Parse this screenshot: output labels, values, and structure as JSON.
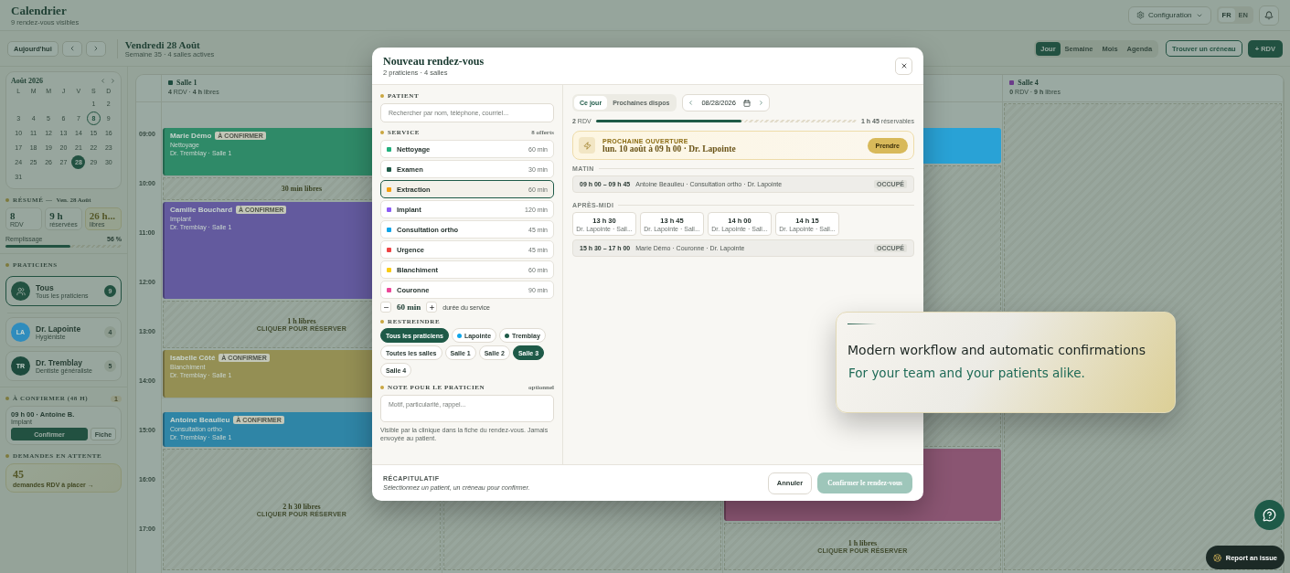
{
  "header": {
    "title": "Calendrier",
    "subtitle": "9 rendez-vous visibles",
    "config_label": "Configuration",
    "languages": [
      {
        "label": "FR",
        "selected": true
      },
      {
        "label": "EN",
        "selected": false
      }
    ]
  },
  "toolbar": {
    "today_label": "Aujourd'hui",
    "date_title": "Vendredi 28 Août",
    "date_subtitle": "Semaine 35 · 4 salles actives",
    "views": [
      {
        "label": "Jour",
        "selected": true
      },
      {
        "label": "Semaine",
        "selected": false
      },
      {
        "label": "Mois",
        "selected": false
      },
      {
        "label": "Agenda",
        "selected": false
      }
    ],
    "find_slot_label": "Trouver un créneau",
    "new_label": "+ RDV"
  },
  "sidebar": {
    "mini_calendar": {
      "title": "Août 2026",
      "weekdays": [
        "L",
        "M",
        "M",
        "J",
        "V",
        "S",
        "D"
      ],
      "weeks": [
        [
          {
            "day": "1",
            "today": false,
            "selected": false
          },
          {
            "day": "2",
            "today": false,
            "selected": false
          }
        ],
        [
          {
            "day": "3",
            "today": false,
            "selected": false
          },
          {
            "day": "4",
            "today": false,
            "selected": false
          },
          {
            "day": "5",
            "today": false,
            "selected": false
          },
          {
            "day": "6",
            "today": false,
            "selected": false
          },
          {
            "day": "7",
            "today": false,
            "selected": false
          },
          {
            "day": "8",
            "today": true,
            "selected": false
          },
          {
            "day": "9",
            "today": false,
            "selected": false
          }
        ],
        [
          {
            "day": "10",
            "today": false,
            "selected": false
          },
          {
            "day": "11",
            "today": false,
            "selected": false
          },
          {
            "day": "12",
            "today": false,
            "selected": false
          },
          {
            "day": "13",
            "today": false,
            "selected": false
          },
          {
            "day": "14",
            "today": false,
            "selected": false
          },
          {
            "day": "15",
            "today": false,
            "selected": false
          },
          {
            "day": "16",
            "today": false,
            "selected": false
          }
        ],
        [
          {
            "day": "17",
            "today": false,
            "selected": false
          },
          {
            "day": "18",
            "today": false,
            "selected": false
          },
          {
            "day": "19",
            "today": false,
            "selected": false
          },
          {
            "day": "20",
            "today": false,
            "selected": false
          },
          {
            "day": "21",
            "today": false,
            "selected": false
          },
          {
            "day": "22",
            "today": false,
            "selected": false
          },
          {
            "day": "23",
            "today": false,
            "selected": false
          }
        ],
        [
          {
            "day": "24",
            "today": false,
            "selected": false
          },
          {
            "day": "25",
            "today": false,
            "selected": false
          },
          {
            "day": "26",
            "today": false,
            "selected": false
          },
          {
            "day": "27",
            "today": false,
            "selected": false
          },
          {
            "day": "28",
            "today": false,
            "selected": true
          },
          {
            "day": "29",
            "today": false,
            "selected": false
          },
          {
            "day": "30",
            "today": false,
            "selected": false
          }
        ],
        [
          {
            "day": "31",
            "today": false,
            "selected": false
          }
        ]
      ]
    },
    "summary": {
      "heading": "RÉSUMÉ —",
      "date": "Ven. 28 Août",
      "stats": [
        {
          "kind": "plain",
          "value": "8",
          "label": "RDV"
        },
        {
          "kind": "plain",
          "value": "9 h",
          "label": "réservées"
        },
        {
          "kind": "highlight",
          "value": "26 h...",
          "label": "libres"
        }
      ],
      "fill_label": "Remplissage",
      "fill_reading": "56 %",
      "level": 0.56
    },
    "practitioners_heading": "PRATICIENS",
    "practitioners": [
      {
        "kind": "all",
        "name": "Tous",
        "role": "Tous les praticiens",
        "count": "9",
        "selected": true
      },
      {
        "kind": "person",
        "initials": "LA",
        "color": "#2f8cbd",
        "name": "Dr. Lapointe",
        "role": "Hygiéniste",
        "count": "4",
        "selected": false
      },
      {
        "kind": "person",
        "initials": "TR",
        "color": "#1d4a3d",
        "name": "Dr. Tremblay",
        "role": "Dentiste généraliste",
        "count": "5",
        "selected": false
      }
    ],
    "to_confirm": {
      "heading": "À CONFIRMER (48 H)",
      "count": "1",
      "items": [
        {
          "title": "09 h 00 · Antoine B.",
          "service": "Implant",
          "confirm_label": "Confirmer",
          "file_label": "Fiche"
        }
      ]
    },
    "pending": {
      "heading": "DEMANDES EN ATTENTE",
      "count": "45",
      "label": "demandes RDV à placer →"
    }
  },
  "calendar": {
    "hours": [
      "09:00",
      "10:00",
      "11:00",
      "12:00",
      "13:00",
      "14:00",
      "15:00",
      "16:00",
      "17:00"
    ],
    "rooms": [
      {
        "name": "Salle 1",
        "color": "#1d4a3d",
        "stats": "**4** RDV · **4 h** libres",
        "blocks": [
          {
            "kind": "event",
            "color": "#2f8a68",
            "patient": "Marie Démo",
            "badge": "À CONFIRMER",
            "service": "Nettoyage",
            "detail": "Dr. Tremblay · Salle 1"
          },
          {
            "kind": "free",
            "label": "30 min libres"
          },
          {
            "kind": "event",
            "color": "#635a9e",
            "patient": "Camille Bouchard",
            "badge": "À CONFIRMER",
            "service": "Implant",
            "detail": "Dr. Tremblay · Salle 1"
          },
          {
            "kind": "free",
            "label": "1 h libres",
            "action": "CLIQUER POUR RÉSERVER"
          },
          {
            "kind": "event",
            "color": "#948f54",
            "patient": "Isabelle Côté",
            "badge": "À CONFIRMER",
            "service": "Blanchiment",
            "detail": "Dr. Tremblay · Salle 1"
          },
          {
            "kind": "event",
            "color": "#2f85a6",
            "patient": "Antoine Beaulieu",
            "badge": "À CONFIRMER",
            "service": "Consultation ortho",
            "detail": "Dr. Tremblay · Salle 1"
          },
          {
            "kind": "free",
            "label": "2 h 30 libres",
            "action": "CLIQUER POUR RÉSERVER"
          }
        ]
      },
      {
        "blocks": [
          {
            "kind": "free"
          }
        ]
      },
      {
        "blocks": [
          {
            "kind": "event",
            "color": "#29a2d6"
          },
          {
            "kind": "free"
          },
          {
            "kind": "event",
            "color": "#8a5572"
          },
          {
            "kind": "free",
            "label": "1 h libres",
            "action": "CLIQUER POUR RÉSERVER"
          }
        ]
      },
      {
        "name": "Salle 4",
        "color": "#6b3c8a",
        "stats": "**0** RDV · **9 h** libres",
        "blocks": [
          {
            "kind": "free"
          }
        ]
      }
    ]
  },
  "modal": {
    "title": "Nouveau rendez-vous",
    "subtitle": "2 praticiens · 4 salles",
    "patient": {
      "heading": "PATIENT",
      "placeholder": "Rechercher par nom, téléphone, courriel..."
    },
    "service": {
      "heading": "SERVICE",
      "count": "8 offerts",
      "items": [
        {
          "name": "Nettoyage",
          "duration": "60 min",
          "color": "#22b07d",
          "selected": false
        },
        {
          "name": "Examen",
          "duration": "30 min",
          "color": "#1e5a48",
          "selected": false
        },
        {
          "name": "Extraction",
          "duration": "60 min",
          "color": "#f59e0b",
          "selected": true
        },
        {
          "name": "Implant",
          "duration": "120 min",
          "color": "#8b5cf6",
          "selected": false
        },
        {
          "name": "Consultation ortho",
          "duration": "45 min",
          "color": "#0ea5e9",
          "selected": false
        },
        {
          "name": "Urgence",
          "duration": "45 min",
          "color": "#ef4444",
          "selected": false
        },
        {
          "name": "Blanchiment",
          "duration": "60 min",
          "color": "#facc15",
          "selected": false
        },
        {
          "name": "Couronne",
          "duration": "90 min",
          "color": "#ec4899",
          "selected": false
        }
      ]
    },
    "duration": {
      "value": "60 min",
      "hint": "durée du service"
    },
    "restrict": {
      "heading": "RESTREINDRE",
      "chips": [
        {
          "label": "Tous les praticiens",
          "selected": true
        },
        {
          "label": "Lapointe",
          "color": "#0ea5e9",
          "selected": false
        },
        {
          "label": "Tremblay",
          "color": "#1e5a48",
          "selected": false
        },
        {
          "label": "Toutes les salles",
          "selected": false
        },
        {
          "label": "Salle 1",
          "selected": false
        },
        {
          "label": "Salle 2",
          "selected": false
        },
        {
          "label": "Salle 3",
          "selected": true
        },
        {
          "label": "Salle 4",
          "selected": false
        }
      ]
    },
    "note": {
      "heading": "NOTE POUR LE PRATICIEN",
      "optional": "optionnel",
      "placeholder": "Motif, particularité, rappel...",
      "help": "Visible par la clinique dans la fiche du rendez-vous. Jamais envoyée au patient."
    },
    "availability": {
      "modes": [
        {
          "label": "Ce jour",
          "selected": true
        },
        {
          "label": "Prochaines dispos",
          "selected": false
        }
      ],
      "date": "08/28/2026",
      "rdv": "**2** RDV",
      "level": 0.56,
      "bookable": "**1 h 45** réservables",
      "next": {
        "kicker": "PROCHAINE OUVERTURE",
        "text": "lun. 10 août à 09 h 00 · Dr. Lapointe",
        "action": "Prendre"
      },
      "sections": [
        {
          "heading": "MATIN",
          "rows": [
            {
              "kind": "busy",
              "time": "09 h 00 – 09 h 45",
              "detail": "Antoine Beaulieu · Consultation ortho · Dr. Lapointe",
              "status": "OCCUPÉ"
            }
          ]
        },
        {
          "heading": "APRÈS-MIDI",
          "rows": [
            {
              "kind": "slots",
              "slots": [
                {
                  "time": "13 h 30",
                  "detail": "Dr. Lapointe · Sall..."
                },
                {
                  "time": "13 h 45",
                  "detail": "Dr. Lapointe · Sall..."
                },
                {
                  "time": "14 h 00",
                  "detail": "Dr. Lapointe · Sall..."
                },
                {
                  "time": "14 h 15",
                  "detail": "Dr. Lapointe · Sall..."
                }
              ]
            },
            {
              "kind": "busy",
              "time": "15 h 30 – 17 h 00",
              "detail": "Marie Démo · Couronne · Dr. Lapointe",
              "status": "OCCUPÉ"
            }
          ]
        }
      ]
    },
    "footer": {
      "heading": "RÉCAPITULATIF",
      "text": "Sélectionnez un patient, un créneau pour confirmer.",
      "cancel": "Annuler",
      "confirm": "Confirmer le rendez-vous",
      "confirm_disabled": true
    }
  },
  "promo": {
    "title": "Modern workflow and automatic confirmations",
    "subtitle": "For your team and your patients alike."
  },
  "report_label": "Report an issue"
}
